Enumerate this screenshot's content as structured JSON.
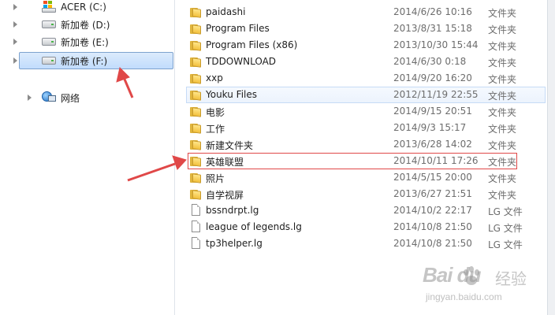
{
  "navigation": {
    "items": [
      {
        "label": "ACER (C:)",
        "icon": "os-drive-icon"
      },
      {
        "label": "新加卷 (D:)",
        "icon": "drive-icon"
      },
      {
        "label": "新加卷 (E:)",
        "icon": "drive-icon"
      },
      {
        "label": "新加卷 (F:)",
        "icon": "drive-icon",
        "selected": true
      },
      {
        "label": "网络",
        "icon": "network-icon"
      }
    ]
  },
  "files": [
    {
      "name": "paidashi",
      "date": "2014/6/26 10:16",
      "type": "文件夹",
      "kind": "folder"
    },
    {
      "name": "Program Files",
      "date": "2013/8/31 15:18",
      "type": "文件夹",
      "kind": "folder"
    },
    {
      "name": "Program Files (x86)",
      "date": "2013/10/30 15:44",
      "type": "文件夹",
      "kind": "folder"
    },
    {
      "name": "TDDOWNLOAD",
      "date": "2014/6/30 0:18",
      "type": "文件夹",
      "kind": "folder"
    },
    {
      "name": "xxp",
      "date": "2014/9/20 16:20",
      "type": "文件夹",
      "kind": "folder"
    },
    {
      "name": "Youku Files",
      "date": "2012/11/19 22:55",
      "type": "文件夹",
      "kind": "folder",
      "hover": true
    },
    {
      "name": "电影",
      "date": "2014/9/15 20:51",
      "type": "文件夹",
      "kind": "folder"
    },
    {
      "name": "工作",
      "date": "2014/9/3 15:17",
      "type": "文件夹",
      "kind": "folder"
    },
    {
      "name": "新建文件夹",
      "date": "2013/6/28 14:02",
      "type": "文件夹",
      "kind": "folder"
    },
    {
      "name": "英雄联盟",
      "date": "2014/10/11 17:26",
      "type": "文件夹",
      "kind": "folder",
      "highlighted": true
    },
    {
      "name": "照片",
      "date": "2014/5/15 20:00",
      "type": "文件夹",
      "kind": "folder"
    },
    {
      "name": "自学视屏",
      "date": "2013/6/27 21:51",
      "type": "文件夹",
      "kind": "folder"
    },
    {
      "name": "bssndrpt.lg",
      "date": "2014/10/2 22:17",
      "type": "LG 文件",
      "kind": "file"
    },
    {
      "name": "league of legends.lg",
      "date": "2014/10/8 21:50",
      "type": "LG 文件",
      "kind": "file"
    },
    {
      "name": "tp3helper.lg",
      "date": "2014/10/8 21:50",
      "type": "LG 文件",
      "kind": "file"
    }
  ],
  "watermark": {
    "logo": "Bai du",
    "text": "经验",
    "url": "jingyan.baidu.com"
  },
  "colors": {
    "annotation_red": "#e04848",
    "selection_blue": "#c1dcfc",
    "folder_yellow": "#f3c13e"
  }
}
